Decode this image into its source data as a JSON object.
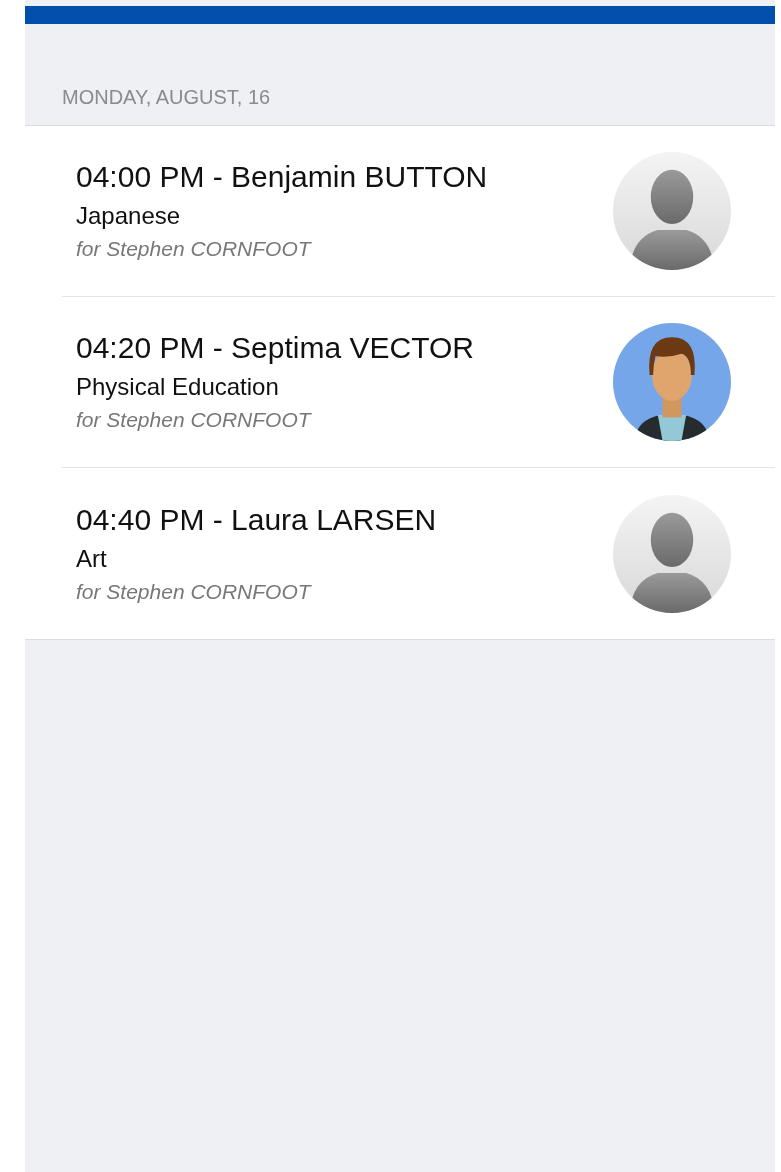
{
  "section_header": "MONDAY, AUGUST, 16",
  "appointments": [
    {
      "title": "04:00 PM - Benjamin BUTTON",
      "subject": "Japanese",
      "for": "for Stephen CORNFOOT",
      "avatar": {
        "kind": "placeholder"
      }
    },
    {
      "title": "04:20 PM - Septima VECTOR",
      "subject": "Physical Education",
      "for": "for Stephen CORNFOOT",
      "avatar": {
        "kind": "illustrated"
      }
    },
    {
      "title": "04:40 PM - Laura LARSEN",
      "subject": "Art",
      "for": "for Stephen CORNFOOT",
      "avatar": {
        "kind": "placeholder"
      }
    }
  ]
}
